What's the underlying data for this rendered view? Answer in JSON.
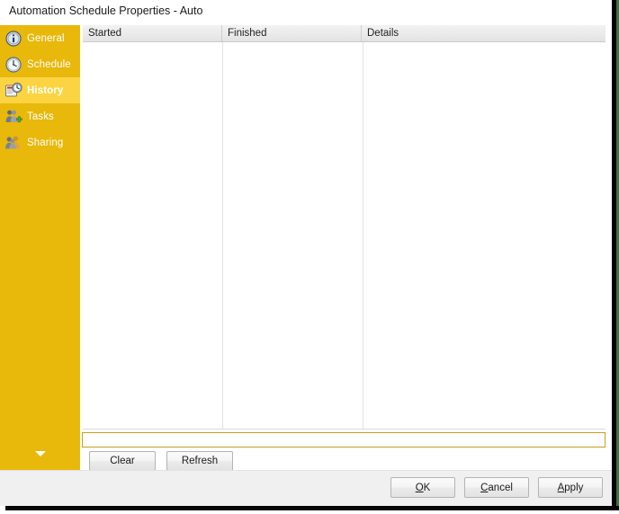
{
  "window": {
    "title": "Automation Schedule Properties - Auto"
  },
  "sidebar": {
    "items": [
      {
        "label": "General",
        "icon": "info-icon",
        "selected": false
      },
      {
        "label": "Schedule",
        "icon": "clock-icon",
        "selected": false
      },
      {
        "label": "History",
        "icon": "history-icon",
        "selected": true
      },
      {
        "label": "Tasks",
        "icon": "tasks-icon",
        "selected": false
      },
      {
        "label": "Sharing",
        "icon": "sharing-icon",
        "selected": false
      }
    ],
    "expander_icon": "chevron-down-icon",
    "background_color": "#e8b80b",
    "selected_color": "#fcd441"
  },
  "history": {
    "columns": [
      {
        "label": "Started"
      },
      {
        "label": "Finished"
      },
      {
        "label": "Details"
      }
    ],
    "rows": [],
    "actions": [
      {
        "label": "Clear"
      },
      {
        "label": "Refresh"
      }
    ]
  },
  "footer": {
    "buttons": [
      {
        "label": "OK",
        "accel": "O",
        "rest": "K"
      },
      {
        "label": "Cancel",
        "accel": "C",
        "rest": "ancel"
      },
      {
        "label": "Apply",
        "accel": "A",
        "rest": "pply"
      }
    ]
  }
}
